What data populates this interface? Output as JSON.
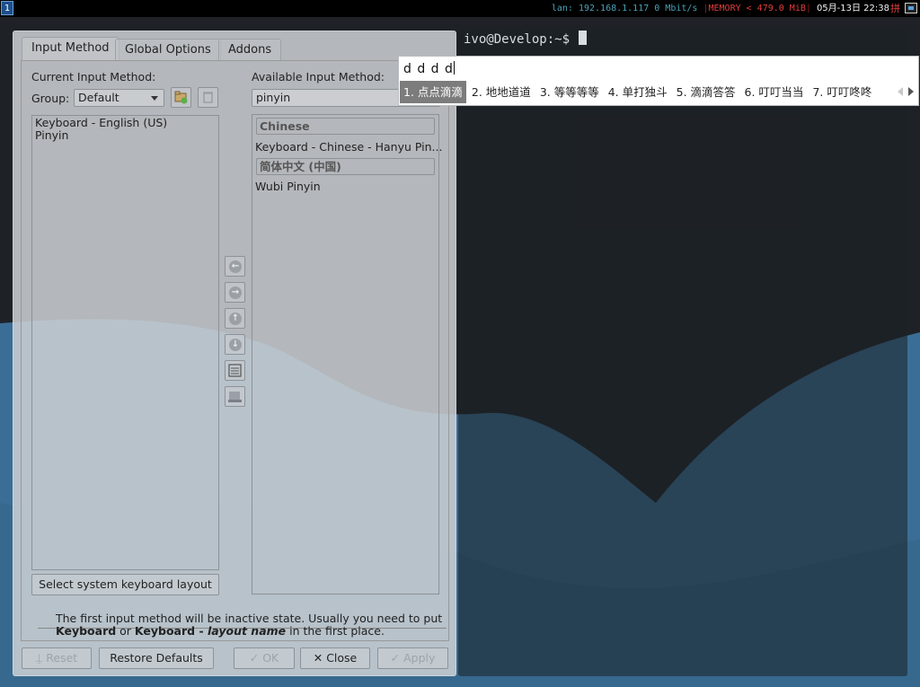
{
  "topbar": {
    "workspace": "1",
    "net": "lan: 192.168.1.117 0 Mbit/s",
    "sep": "|",
    "memory": "MEMORY < 479.0 MiB",
    "sep2": "|",
    "datetime": "05月-13日 22:38",
    "ime_indicator": "拼"
  },
  "terminal": {
    "prompt": "ivo@Develop:~$"
  },
  "dialog": {
    "tabs": [
      "Input Method",
      "Global Options",
      "Addons"
    ],
    "current_label": "Current Input Method:",
    "group_label": "Group:",
    "group_value": "Default",
    "current_items": [
      "Keyboard - English (US)",
      "Pinyin"
    ],
    "available_label": "Available Input Method:",
    "search_value": "pinyin",
    "available": [
      {
        "category": "Chinese",
        "items": [
          "Keyboard - Chinese - Hanyu Pin..."
        ]
      },
      {
        "category": "简体中文 (中国)",
        "items": [
          "Wubi Pinyin"
        ]
      }
    ],
    "select_layout_button": "Select system keyboard layout",
    "note_line1": "The first input method will be inactive state. Usually you need to put",
    "note_kw1": "Keyboard",
    "note_or": " or ",
    "note_kw2": "Keyboard - ",
    "note_layout": "layout name",
    "note_tail": " in the first place.",
    "buttons": {
      "reset": "Reset",
      "restore": "Restore Defaults",
      "ok": "OK",
      "close": "Close",
      "apply": "Apply"
    }
  },
  "ime": {
    "preedit": "d d d d",
    "candidates": [
      "1. 点点滴滴",
      "2. 地地道道",
      "3. 等等等等",
      "4. 单打独斗",
      "5. 滴滴答答",
      "6. 叮叮当当",
      "7. 叮叮咚咚"
    ],
    "selected_index": 0
  },
  "colors": {
    "desktop": "#1e2226",
    "wave": "#3b6e96",
    "selection": "#7c7c7c"
  }
}
